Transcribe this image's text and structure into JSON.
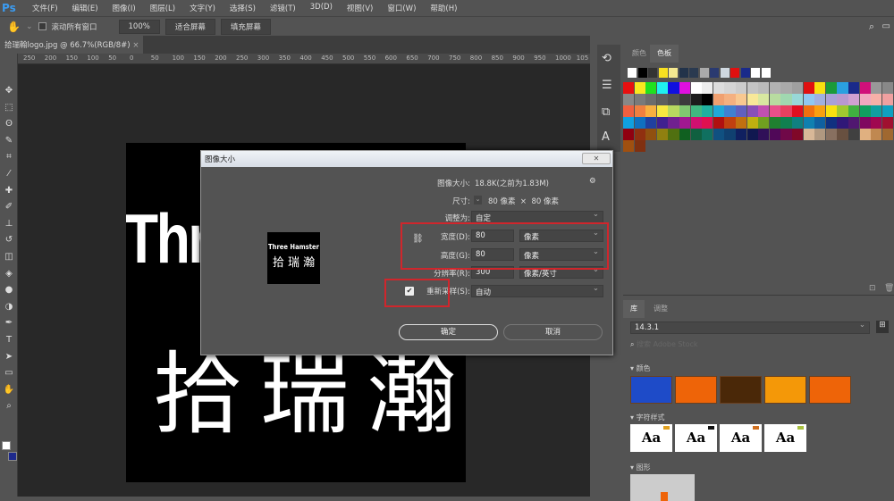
{
  "app": {
    "logo": "Ps"
  },
  "menu": [
    "文件(F)",
    "编辑(E)",
    "图像(I)",
    "图层(L)",
    "文字(Y)",
    "选择(S)",
    "滤镜(T)",
    "3D(D)",
    "视图(V)",
    "窗口(W)",
    "帮助(H)"
  ],
  "options": {
    "scroll_all": "滚动所有窗口",
    "zoom": "100%",
    "fit": "适合屏幕",
    "fill": "填充屏幕"
  },
  "doc_tab": {
    "title": "拾瑞翰logo.jpg @ 66.7%(RGB/8#)",
    "close": "×"
  },
  "ruler": [
    "250",
    "200",
    "150",
    "100",
    "50",
    "0",
    "50",
    "100",
    "150",
    "200",
    "250",
    "300",
    "350",
    "400",
    "450",
    "500",
    "550",
    "600",
    "650",
    "700",
    "750",
    "800",
    "850",
    "900",
    "950",
    "1000",
    "105"
  ],
  "canvas": {
    "text_top": "Thr",
    "text_bottom": "拾 瑞 瀚"
  },
  "right_panel": {
    "tabs": [
      "颜色",
      "色板"
    ],
    "active_tab": "色板",
    "swatches": [
      [
        "#ffffff",
        "#000000",
        "#333333",
        "#f8e020",
        "#f4e890",
        "#22334a",
        "#2a3a50",
        "#aaaaaa",
        "#2a3a70",
        "#cfd8e0",
        "#e01010",
        "#1a2a8a",
        "#ffffff",
        "#ffffff"
      ],
      [
        "#e81010",
        "#f8e820",
        "#20e020",
        "#20f0f0",
        "#1010e0",
        "#e010e0",
        "#ffffff",
        "#eeeeee",
        "#dddddd",
        "#d5d5d5",
        "#cccccc",
        "#c4c4c4",
        "#bbbbbb",
        "#b2b2b2",
        "#aaaaaa",
        "#a0a0a0",
        "#e01010",
        "#f8e010",
        "#1a9a3a",
        "#2aa0e0",
        "#1a2a8a",
        "#d0107a",
        "#999999",
        "#888888"
      ],
      [
        "#888888",
        "#7a7a7a",
        "#6c6c6c",
        "#5e5e5e",
        "#505050",
        "#3c3c3c",
        "#1c1c1c",
        "#000000",
        "#f0a070",
        "#f4b080",
        "#f8c890",
        "#f8e898",
        "#d8e8a0",
        "#b8dca0",
        "#a0d8b0",
        "#98d8d8",
        "#90c8f0",
        "#a0b0e0",
        "#a8a0d8",
        "#b898d0",
        "#d0a0d0",
        "#f0a8c0",
        "#f8b0a8",
        "#f0a0a0"
      ],
      [
        "#f06040",
        "#f08040",
        "#f8b040",
        "#f8e840",
        "#b8d860",
        "#80c870",
        "#40b880",
        "#20b0a0",
        "#20a8d8",
        "#4080d0",
        "#6060c0",
        "#8850b8",
        "#c050b0",
        "#e8508a",
        "#e84060",
        "#e01020",
        "#f07010",
        "#f8a010",
        "#f8e010",
        "#a0c830",
        "#40b040",
        "#10a060",
        "#10a0a0",
        "#10a0c0"
      ],
      [
        "#10a0e0",
        "#1070c0",
        "#2040a0",
        "#402090",
        "#702090",
        "#a01890",
        "#d01070",
        "#e01050",
        "#b01010",
        "#c04010",
        "#c07010",
        "#c0b010",
        "#70a020",
        "#208030",
        "#108050",
        "#108080",
        "#1080b0",
        "#1060a0",
        "#103080",
        "#301878",
        "#501870",
        "#800860",
        "#a00850",
        "#a01030"
      ],
      [
        "#900010",
        "#903010",
        "#905010",
        "#908010",
        "#507010",
        "#106020",
        "#106040",
        "#107060",
        "#105080",
        "#104070",
        "#102060",
        "#101850",
        "#301058",
        "#500858",
        "#700848",
        "#800828",
        "#d8b898",
        "#b09880",
        "#887060",
        "#685040",
        "#404040",
        "#e0b080",
        "#c08850",
        "#a06830"
      ],
      [
        "#a05010",
        "#803010"
      ]
    ]
  },
  "library": {
    "tabs": [
      "库",
      "调整"
    ],
    "library_name": "14.3.1",
    "search_placeholder": "搜索 Adobe Stock",
    "colors_label": "颜色",
    "colors": [
      "#1e4bc8",
      "#ee6408",
      "#4a2808",
      "#f49808",
      "#ee6408"
    ],
    "char_styles_label": "字符样式",
    "char_styles": [
      {
        "text": "Aa",
        "tag": "#e0a020"
      },
      {
        "text": "Aa",
        "tag": "#111111"
      },
      {
        "text": "Aa",
        "tag": "#d07020"
      },
      {
        "text": "Aa",
        "tag": "#a8c040"
      }
    ],
    "graphics_label": "图形"
  },
  "dialog": {
    "title": "图像大小",
    "close": "✕",
    "preview_line1": "Three Hamster",
    "preview_line2": "拾 瑞 瀚",
    "size_label": "图像大小:",
    "size_value": "18.8K(之前为1.83M)",
    "dims_label": "尺寸:",
    "dims_value": "80 像素  ×  80 像素",
    "fit_label": "调整为:",
    "fit_value": "自定",
    "width_label": "宽度(D):",
    "width_value": "80",
    "width_unit": "像素",
    "height_label": "高度(G):",
    "height_value": "80",
    "height_unit": "像素",
    "res_label": "分辨率(R):",
    "res_value": "300",
    "res_unit": "像素/英寸",
    "resample_label": "重新采样(S):",
    "resample_checked": true,
    "resample_value": "自动",
    "ok": "确定",
    "cancel": "取消",
    "highlight_color": "#d0262c"
  }
}
